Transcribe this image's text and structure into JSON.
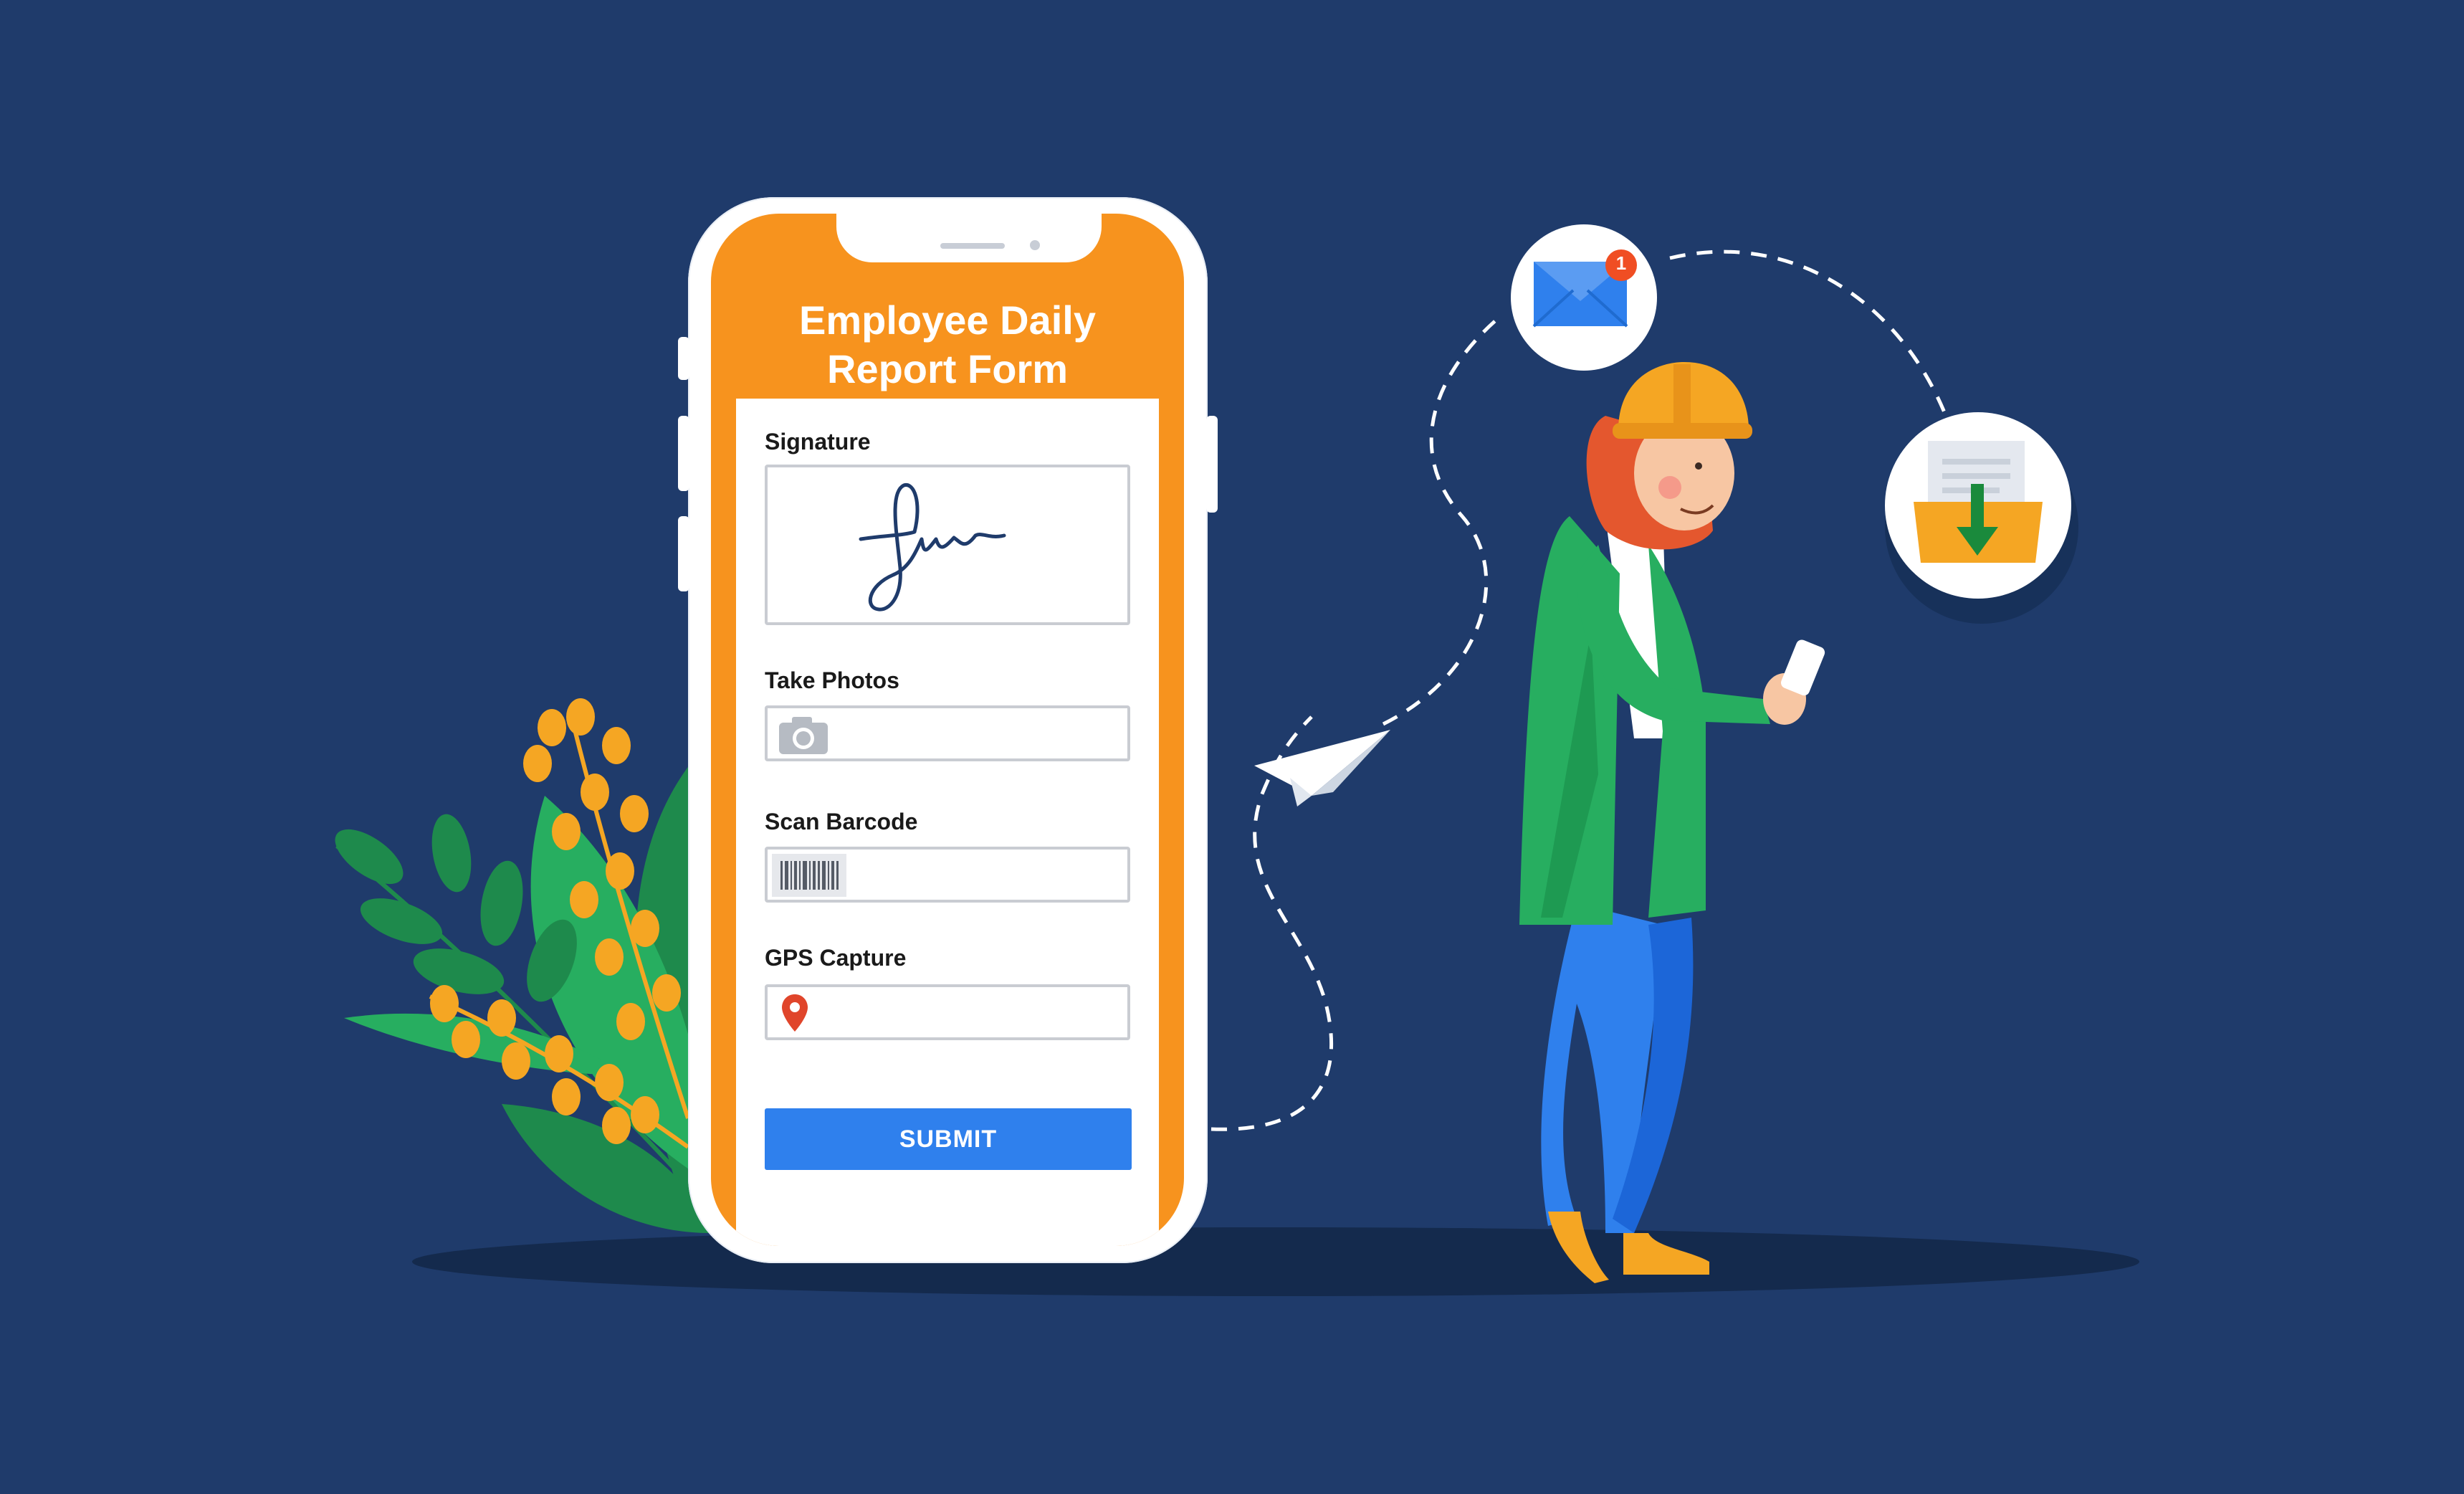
{
  "form": {
    "title": "Employee Daily\nReport Form",
    "fields": [
      {
        "label": "Signature",
        "icon": "signature"
      },
      {
        "label": "Take Photos",
        "icon": "camera-icon"
      },
      {
        "label": "Scan Barcode",
        "icon": "barcode-icon"
      },
      {
        "label": "GPS Capture",
        "icon": "map-pin-icon"
      }
    ],
    "submit_label": "SUBMIT"
  },
  "notification": {
    "badge_count": "1",
    "icon": "envelope-icon"
  },
  "download": {
    "icon": "download-folder-icon"
  },
  "colors": {
    "background": "#1f3b6b",
    "phone_accent": "#f7931e",
    "submit": "#2f80ed",
    "badge": "#f04e23",
    "coat": "#27ae60",
    "jeans": "#2f80ed",
    "helmet": "#f5a623"
  }
}
